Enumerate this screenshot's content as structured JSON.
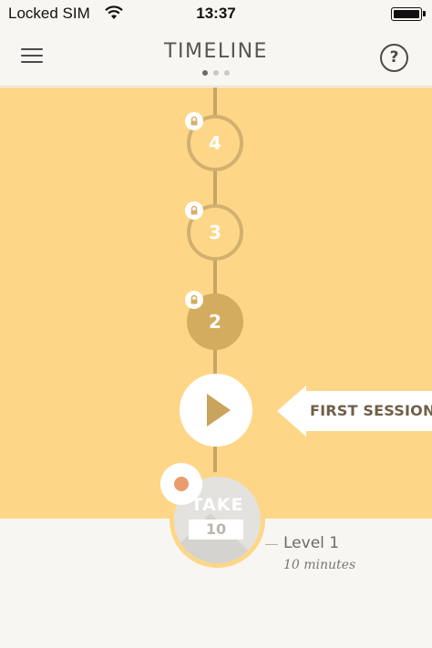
{
  "status_bar": {
    "carrier": "Locked SIM",
    "time": "13:37",
    "wifi_icon": "wifi-icon",
    "battery_level": 1.0
  },
  "header": {
    "title": "TIMELINE",
    "menu_icon": "hamburger-menu-icon",
    "help_label": "?",
    "pager": {
      "pages": 3,
      "active": 1
    }
  },
  "timeline": {
    "nodes": [
      {
        "label": "4",
        "locked": true,
        "state": "locked"
      },
      {
        "label": "3",
        "locked": true,
        "state": "locked"
      },
      {
        "label": "2",
        "locked": true,
        "state": "next"
      }
    ],
    "play_icon": "play-icon",
    "callout_label": "FIRST SESSION",
    "lock_icon": "lock-icon"
  },
  "level": {
    "take_label": "TAKE",
    "take_value": "10",
    "name": "Level 1",
    "duration": "10 minutes"
  },
  "colors": {
    "timeline_bg": "#fed687",
    "track": "#c8a566",
    "current_node": "#d4ac5f",
    "badge_dot": "#ea9d6c",
    "page_bg": "#f7f6f2"
  }
}
